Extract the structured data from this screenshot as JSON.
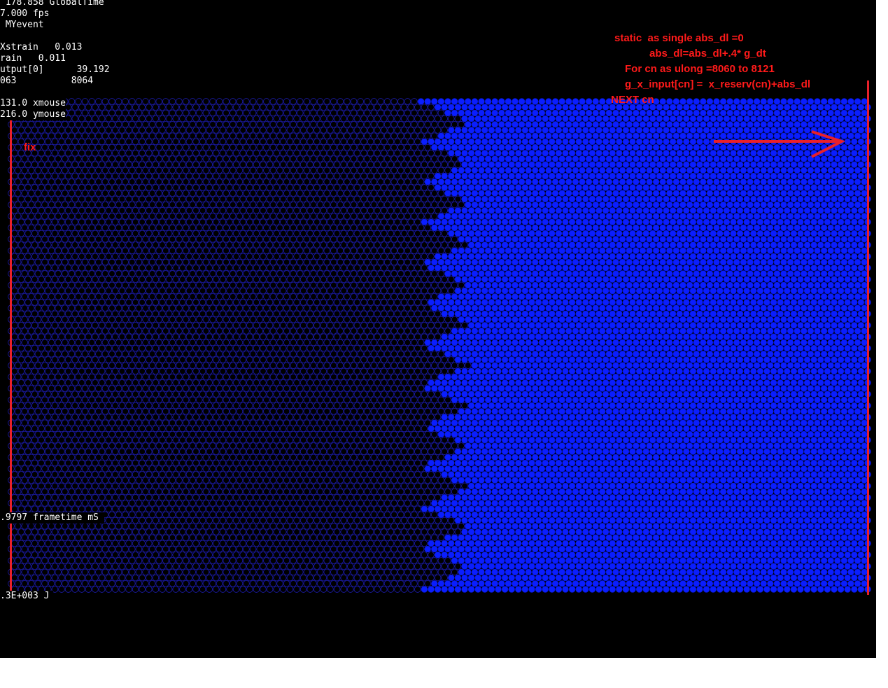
{
  "hud": {
    "global_time": " 178.858 GlobalTime",
    "fps": "7.000 fps",
    "event": " MYevent",
    "xstrain": "Xstrain   0.013",
    "strain": "rain   0.011",
    "output": "utput[0]      39.192",
    "range": "063          8064",
    "xmouse": "131.0 xmouse",
    "ymouse": "216.0 ymouse",
    "frametime": ".9797 frametime mS",
    "energy": ".3E+003 J"
  },
  "annotation": {
    "fix_label": "fix",
    "code_lines": [
      "static  as single abs_dl =0",
      "abs_dl=abs_dl+.4* g_dt",
      "For cn as ulong =8060 to 8121",
      "g_x_input[cn] =  x_reserv(cn)+abs_dl",
      "NEXT cn"
    ],
    "arrow_direction": "right"
  },
  "colors": {
    "background": "#000000",
    "open_particle": "#1a1aa0",
    "filled_particle": "#0a1eff",
    "annotation": "#ff1a1a"
  }
}
